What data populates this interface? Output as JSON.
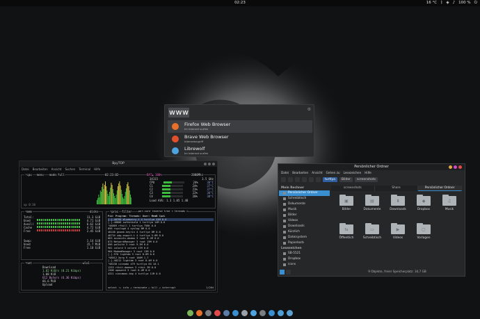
{
  "topbar": {
    "clock": "02:23",
    "weather": "16 °C",
    "battery": "100 %"
  },
  "launcher": {
    "query": "www",
    "results": [
      {
        "name": "Firefox Web Browser",
        "desc": "Im Internet surfen",
        "color": "#e8702a"
      },
      {
        "name": "Brave Web Browser",
        "desc": "Internetzugriff",
        "color": "#e0502a"
      },
      {
        "name": "Librewolf",
        "desc": "Im Internet surfen",
        "color": "#4da3e0"
      }
    ]
  },
  "terminal": {
    "title": "BpyTOP",
    "menu": [
      "Datei",
      "Bearbeiten",
      "Ansicht",
      "Suchen",
      "Terminal",
      "Hilfe"
    ],
    "cpu_header": "¹cpu",
    "cpu_menu": "menu",
    "cpu_mode": "mode:full",
    "cpu_time": "02:23:02",
    "cpu_clock": "2000Mhz",
    "cpu_bat": "BAT▲ 100%",
    "cpu_model": "34115",
    "cpu_ghz": "3.5 GHz",
    "uptime": "up 0:10",
    "load": "Load AVG:  1.3   1.05   1.48",
    "cores": [
      {
        "name": "CPU",
        "pct": "24%",
        "temp": "36°C"
      },
      {
        "name": "C1",
        "pct": "24%",
        "temp": "37°C"
      },
      {
        "name": "C2",
        "pct": "23%",
        "temp": "37°C"
      },
      {
        "name": "C3",
        "pct": "22%",
        "temp": "36°C"
      },
      {
        "name": "C4",
        "pct": "20%",
        "temp": "38°C"
      }
    ],
    "mem": {
      "header": "²mem",
      "total": "11.3 GiB",
      "used": "4.71 GiB",
      "available": "6.62 GiB",
      "cache": "4.72 GiB",
      "free": "2.45 GiB",
      "swap": "1.14 GiB",
      "swap_used": "15.7 MiB",
      "swap_free": "1.10 GiB",
      "disks_label": "disks"
    },
    "net": {
      "header": "³net",
      "download_label": "Download",
      "dl_rate": "1.82 KiB/s (0.21 Kibps)",
      "dl_top": "1.08 KiB",
      "ul_label": "Upload",
      "ul_rate": "612 Byte/s (6.36 Kibps)",
      "ul_total": "66.6 MiB",
      "iface": "wlo1"
    },
    "proc": {
      "header": "⁴proc",
      "filter": "filter",
      "tabs": "per-core  reverse  tree  < threads >",
      "cols": "Pid:   Program:   Threads: User:   MemB   Cpu%",
      "rows": [
        "[-]-48795 blueberry-t   4 turtlya  42M   0.0",
        "[-]-48808 safeshield   1 turtlya  14M   0.0",
        "    └48809 rfkill      1 turtlya 756K   0.0",
        "  898 rsyslogd         4 syslog   8M   0.0",
        "  48248 gnome-keyrin   4 turtlya  8M   0.0",
        "  48734 xdg-export-t   4 turtlya 5.6M   0.0",
        "  863 accounts-daemo   3 root   8.2M   0.0",
        "  873 NetworkManager   3 root   19M   0.0",
        "  896 polkitd          3 root   9.3M   0.0",
        "  901 colord           3 colord  17M   0.0",
        "  964 ModemManager     3 root   13M   0.0",
        "[-]-970 lightdm        3 root   8.6M   0.0",
        "  └48012 Xorg          9 root  166M   1.7",
        "[-]-48212 lightdm      3 root   8.4M   0.0",
        "  └48238 cinnamo     479 turtlya  6G  10.1",
        "  1253 rtkit-daemon    3 rtkit   3M   0.0",
        "  1308 upowerd         3 root   8.4M   0.0",
        "  4321 cinnamon-tmp    4 turtlya 11M   0.0"
      ],
      "footer": "select ↑↓ info ↵ terminate ↵ kill ↵ interrupt",
      "count": "1/204"
    }
  },
  "filemanager": {
    "title": "Persönlicher Ordner",
    "menu": [
      "Datei",
      "Bearbeiten",
      "Ansicht",
      "Gehen zu",
      "Lesezeichen",
      "Hilfe"
    ],
    "breadcrumbs": [
      "turtlya",
      "Bilder",
      "screenshots"
    ],
    "tabs": [
      "screenshots",
      "Share",
      "Persönlicher Ordner"
    ],
    "sections": {
      "mine": "Mein Rechner",
      "bookmarks": "Lesezeichen"
    },
    "places": [
      "Persönlicher Ordner",
      "Schreibtisch",
      "Dokumente",
      "Musik",
      "Bilder",
      "Videos",
      "Downloads",
      "Kürzlich",
      "Dateisystem",
      "Papierkorb"
    ],
    "bookmarks": [
      "SB-5521",
      "Dropbox",
      "icons"
    ],
    "files": [
      {
        "name": "Bilder",
        "glyph": "▣"
      },
      {
        "name": "Dokumente",
        "glyph": "▤"
      },
      {
        "name": "Downloads",
        "glyph": "⬇"
      },
      {
        "name": "Dropbox",
        "glyph": "◆"
      },
      {
        "name": "Musik",
        "glyph": "♫"
      },
      {
        "name": "Öffentlich",
        "glyph": "⇆"
      },
      {
        "name": "Schreibtisch",
        "glyph": "▭"
      },
      {
        "name": "Videos",
        "glyph": "▶"
      },
      {
        "name": "Vorlagen",
        "glyph": "▢"
      }
    ],
    "status": "9 Objekte, freier Speicherplatz: 34,7 GB",
    "dots": [
      "#e0a640",
      "#d04bc6",
      "#e24a4a"
    ]
  },
  "dock": {
    "colors": [
      "#7ab35a",
      "#e8702a",
      "#7a7d82",
      "#e24a4a",
      "#5b7ba8",
      "#3a8fd0",
      "#9aa0a6",
      "#4da3e0",
      "#7a7d82",
      "#3a8fd0",
      "#4d9fd8",
      "#5aa0d0"
    ]
  }
}
